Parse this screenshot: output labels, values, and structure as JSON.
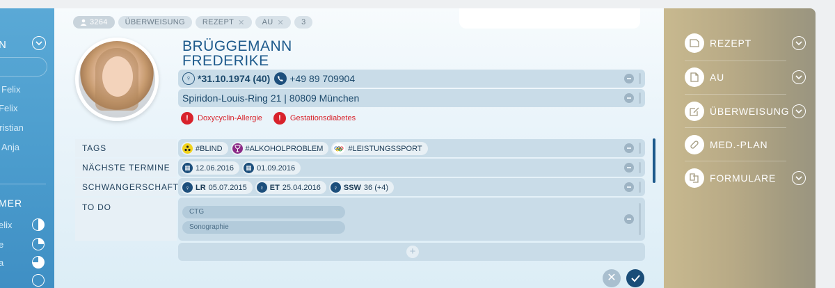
{
  "sidebar": {
    "heading": "N",
    "items": [
      "Felix",
      "Felix",
      "hristian",
      "Anja"
    ],
    "section2_heading": "MER",
    "section2_items": [
      "elix",
      "e",
      "a",
      ""
    ]
  },
  "header": {
    "patient_count": "3264",
    "chips": [
      {
        "label": "ÜBERWEISUNG",
        "closable": false
      },
      {
        "label": "REZEPT",
        "closable": true
      },
      {
        "label": "AU",
        "closable": true
      },
      {
        "label": "3",
        "closable": false
      }
    ]
  },
  "patient": {
    "last_name": "BRÜGGEMANN",
    "first_name": "FREDERIKE",
    "birthdate": "*31.10.1974 (40)",
    "phone": "+49 89 709904",
    "address": "Spiridon-Louis-Ring 21 | 80809 München",
    "alerts": [
      "Doxycyclin-Allergie",
      "Gestationsdiabetes"
    ]
  },
  "fields": {
    "tags_label": "TAGS",
    "tags": [
      {
        "label": "#BLIND",
        "color": "#f2d31b"
      },
      {
        "label": "#ALKOHOLPROBLEM",
        "color": "#8b2a86"
      },
      {
        "label": "#LEISTUNGSSPORT",
        "color": "#ffffff"
      }
    ],
    "appointments_label": "NÄCHSTE TERMINE",
    "appointments": [
      "12.06.2016",
      "01.09.2016"
    ],
    "pregnancy_label": "SCHWANGERSCHAFT",
    "pregnancy": [
      {
        "key": "LR",
        "value": "05.07.2015"
      },
      {
        "key": "ET",
        "value": "25.04.2016"
      },
      {
        "key": "SSW",
        "value": "36 (+4)"
      }
    ],
    "todo_label": "TO DO",
    "todos": [
      "CTG",
      "Sonographie"
    ]
  },
  "actions": {
    "add": "+",
    "cancel": "✕"
  },
  "right_menu": [
    {
      "label": "REZEPT",
      "icon": "prescription-icon",
      "expandable": true
    },
    {
      "label": "AU",
      "icon": "document-icon",
      "expandable": true
    },
    {
      "label": "ÜBERWEISUNG",
      "icon": "referral-icon",
      "expandable": true
    },
    {
      "label": "MED.-PLAN",
      "icon": "pill-icon",
      "expandable": false
    },
    {
      "label": "FORMULARE",
      "icon": "forms-icon",
      "expandable": true
    }
  ],
  "colors": {
    "accent": "#1d5a8c",
    "alert": "#d8222b",
    "sidebar": "#4b9ccd",
    "right_panel": "#b8aa86"
  }
}
